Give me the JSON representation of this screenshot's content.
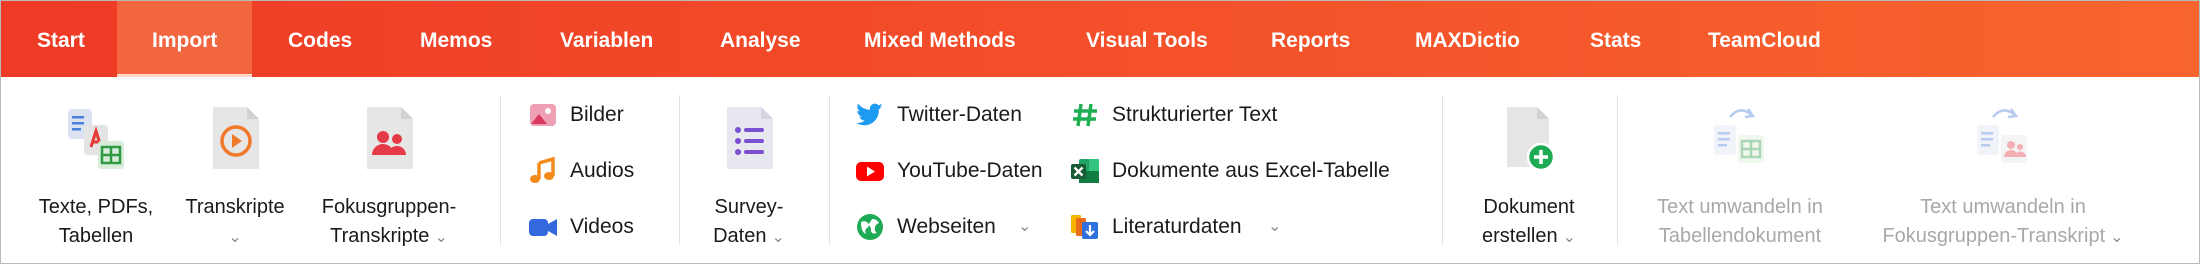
{
  "tabs": [
    "Start",
    "Import",
    "Codes",
    "Memos",
    "Variablen",
    "Analyse",
    "Mixed Methods",
    "Visual Tools",
    "Reports",
    "MAXDictio",
    "Stats",
    "TeamCloud"
  ],
  "active_tab": "Import",
  "ribbon": {
    "texte": {
      "line1": "Texte, PDFs,",
      "line2": "Tabellen"
    },
    "transkripte": {
      "line1": "Transkripte"
    },
    "fokus": {
      "line1": "Fokusgruppen-",
      "line2": "Transkripte"
    },
    "bilder": "Bilder",
    "audios": "Audios",
    "videos": "Videos",
    "survey": {
      "line1": "Survey-",
      "line2": "Daten"
    },
    "twitter": "Twitter-Daten",
    "youtube": "YouTube-Daten",
    "webseiten": "Webseiten",
    "strukt": "Strukturierter Text",
    "excel": "Dokumente aus Excel-Tabelle",
    "literatur": "Literaturdaten",
    "dokument": {
      "line1": "Dokument",
      "line2": "erstellen"
    },
    "umwandeln_tabelle": {
      "line1": "Text umwandeln in",
      "line2": "Tabellendokument"
    },
    "umwandeln_fokus": {
      "line1": "Text umwandeln in",
      "line2": "Fokusgruppen-Transkript"
    }
  },
  "chevron": "⌄",
  "colors": {
    "tabbar_start": "#ee3a26",
    "tabbar_end": "#f7652e",
    "disabled_text": "#a8a8a8"
  }
}
